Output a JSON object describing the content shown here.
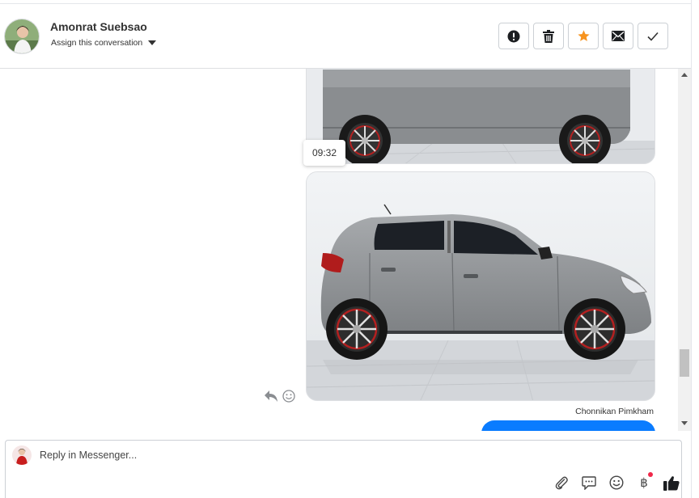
{
  "header": {
    "contact_name": "Amonrat Suebsao",
    "assign_label": "Assign this conversation",
    "actions": [
      {
        "name": "spam-button",
        "icon": "exclamation-circle-icon"
      },
      {
        "name": "delete-button",
        "icon": "trash-icon"
      },
      {
        "name": "star-button",
        "icon": "star-icon"
      },
      {
        "name": "mark-unread-button",
        "icon": "envelope-icon"
      },
      {
        "name": "mark-done-button",
        "icon": "checkmark-icon"
      }
    ]
  },
  "conversation": {
    "timestamp": "09:32",
    "sender_name": "Chonnikan Pimkham",
    "photos": [
      {
        "name": "car-photo-1",
        "subject": "grey hatchback side view"
      },
      {
        "name": "car-photo-2",
        "subject": "grey hatchback side view"
      }
    ]
  },
  "composer": {
    "placeholder": "Reply in Messenger...",
    "tools": [
      "paperclip-icon",
      "speech-bubble-icon",
      "emoji-icon",
      "baht-icon",
      "thumbs-up-icon"
    ],
    "baht_symbol": "฿"
  },
  "colors": {
    "accent_blue": "#0a7cff",
    "star_orange": "#f7931e",
    "notification_red": "#f02849"
  }
}
